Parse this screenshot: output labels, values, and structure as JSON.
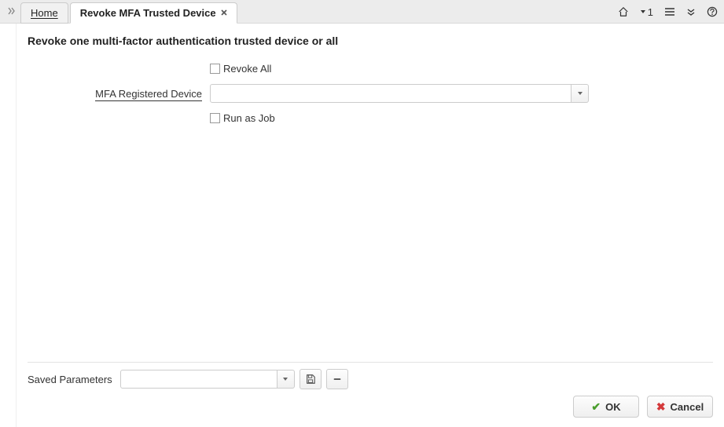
{
  "topbar": {
    "tabs": {
      "home": "Home",
      "active": "Revoke MFA Trusted Device"
    },
    "count": "1"
  },
  "page": {
    "title": "Revoke one multi-factor authentication trusted device or all"
  },
  "form": {
    "revoke_all_label": "Revoke All",
    "device_label": "MFA Registered Device",
    "device_value": "",
    "run_as_job_label": "Run as Job"
  },
  "saved": {
    "label": "Saved Parameters",
    "value": ""
  },
  "buttons": {
    "ok": "OK",
    "cancel": "Cancel"
  }
}
